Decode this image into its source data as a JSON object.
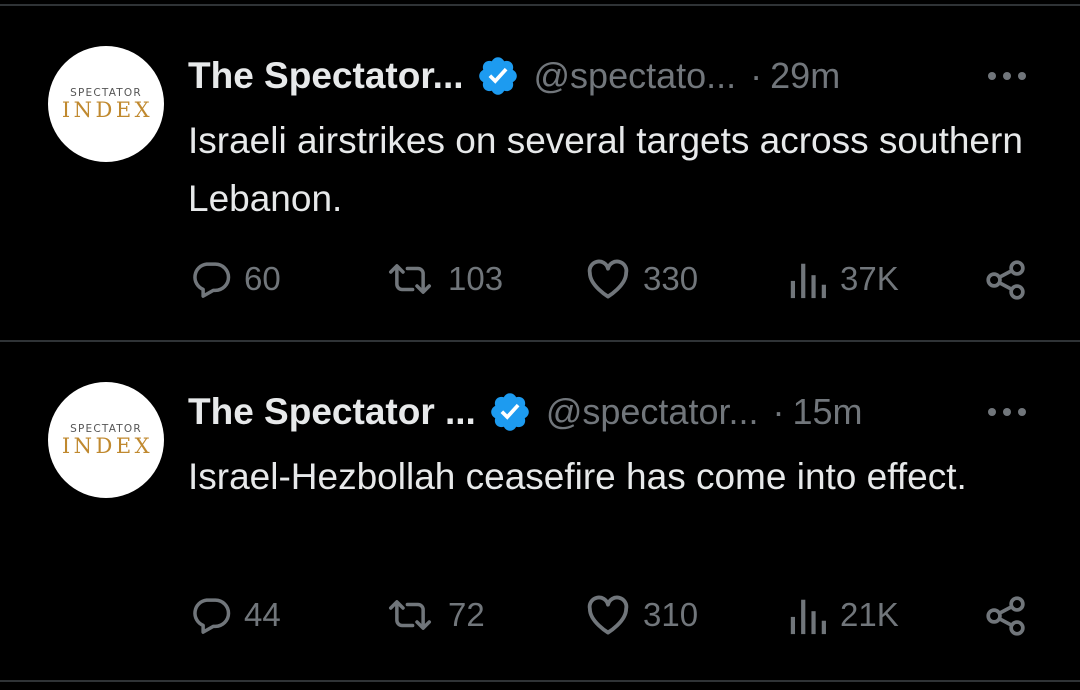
{
  "tweets": [
    {
      "account": {
        "avatar_top_text": "SPECTATOR",
        "avatar_bottom_text": "INDEX",
        "display_name": "The Spectator...",
        "handle": "@spectato...",
        "time": "29m"
      },
      "text": "Israeli airstrikes on several targets across southern Lebanon.",
      "stats": {
        "replies": "60",
        "reposts": "103",
        "likes": "330",
        "views": "37K"
      }
    },
    {
      "account": {
        "avatar_top_text": "SPECTATOR",
        "avatar_bottom_text": "INDEX",
        "display_name": "The Spectator ...",
        "handle": "@spectator...",
        "time": "15m"
      },
      "text": "Israel-Hezbollah ceasefire has come into effect.",
      "stats": {
        "replies": "44",
        "reposts": "72",
        "likes": "310",
        "views": "21K"
      }
    }
  ],
  "separator": "·",
  "colors": {
    "background": "#000000",
    "primary_text": "#e7e9ea",
    "secondary_text": "#71767b",
    "verified_badge": "#1d9bf0",
    "divider": "#2f3336"
  },
  "icons": {
    "reply": "speech-bubble-icon",
    "repost": "repost-arrows-icon",
    "like": "heart-icon",
    "views": "bar-chart-icon",
    "share": "share-nodes-icon",
    "more": "three-dots-icon",
    "verified": "verified-badge-icon"
  }
}
